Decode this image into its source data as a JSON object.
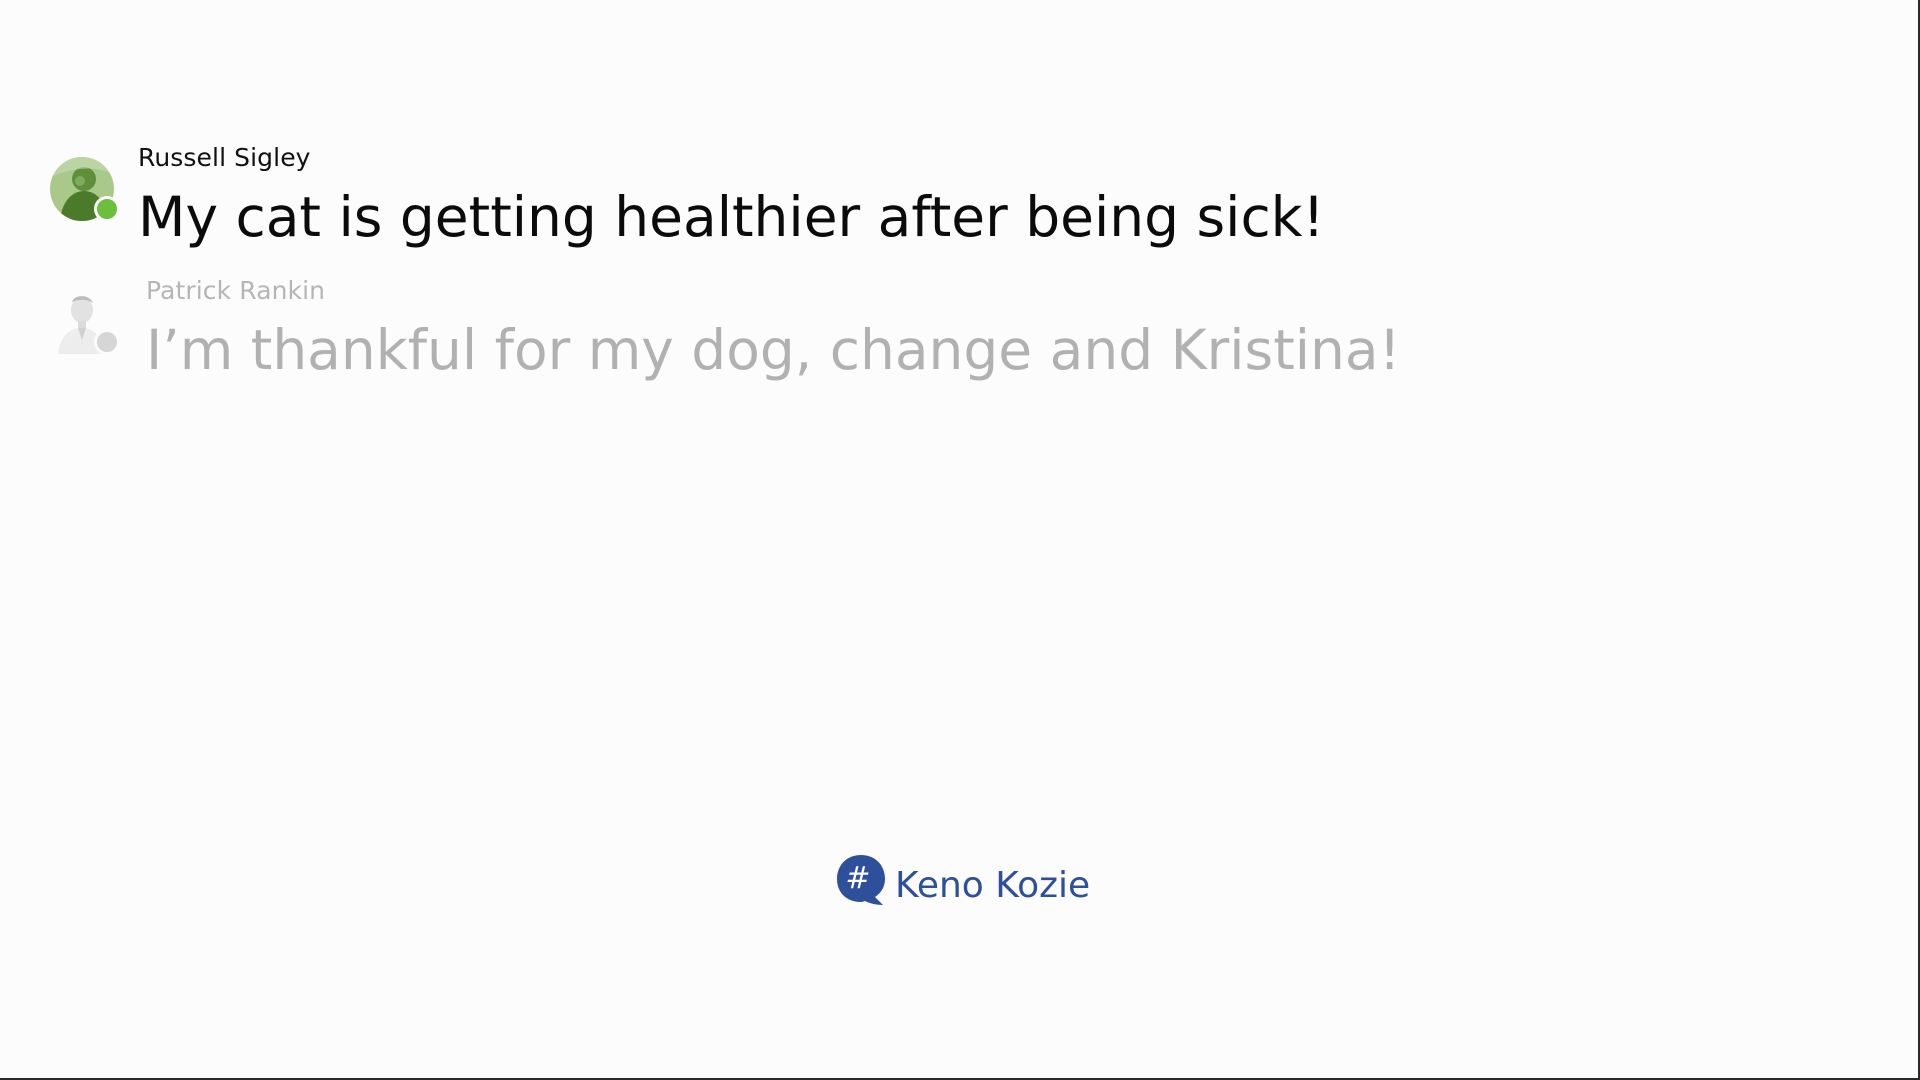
{
  "colors": {
    "background": "#fcfcfc",
    "presence_online": "#6bbf3c",
    "presence_idle": "#9a9a9a",
    "brand": "#2e4f9a"
  },
  "posts": [
    {
      "author": "Russell Sigley",
      "message": "My cat is getting healthier after being sick!",
      "avatar_icon": "user-avatar-photo",
      "presence_icon": "online-status-dot",
      "faded": false
    },
    {
      "author": "Patrick Rankin",
      "message": "I’m thankful for my dog, change and Kristina!",
      "avatar_icon": "user-avatar-photo",
      "presence_icon": "status-dot",
      "faded": true
    }
  ],
  "brand": {
    "icon": "hashtag-speech-bubble-icon",
    "symbol": "#",
    "name": "Keno Kozie"
  }
}
